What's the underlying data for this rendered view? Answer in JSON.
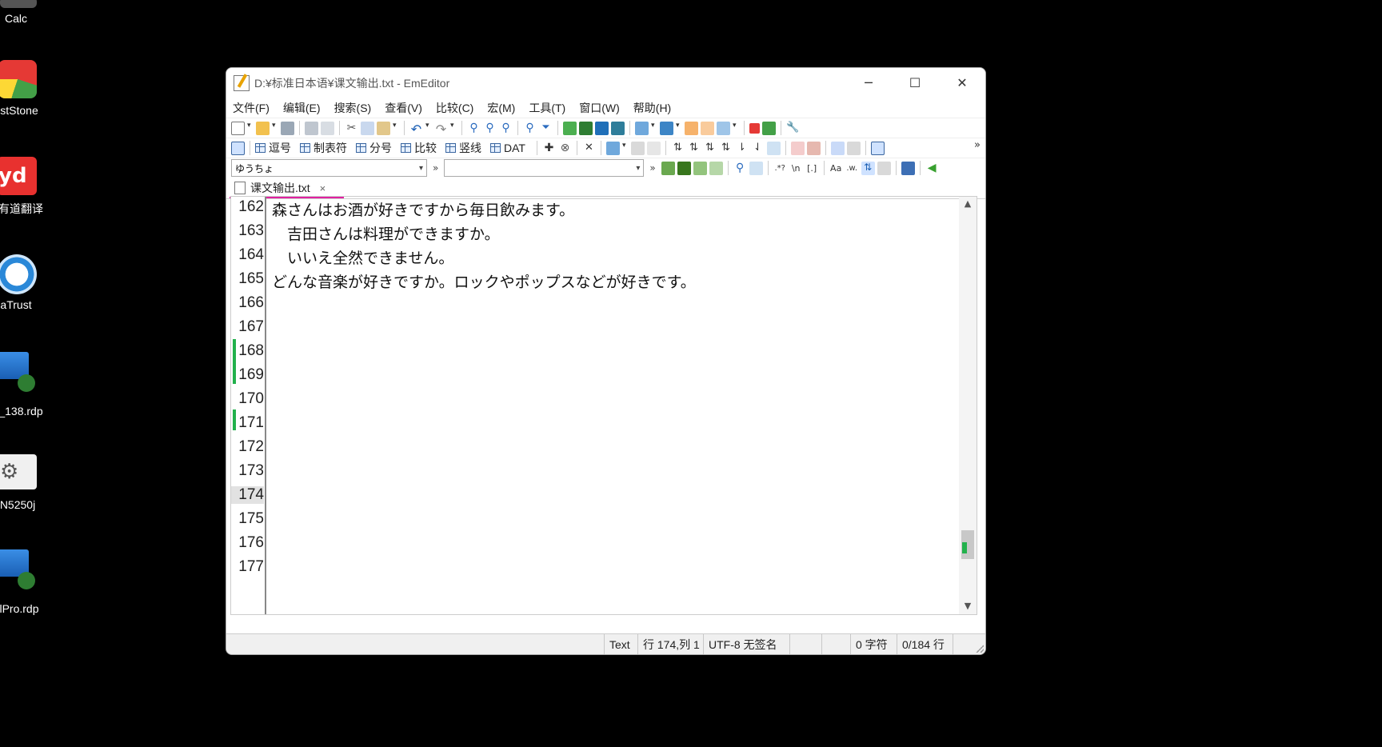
{
  "desktop": {
    "icons": [
      {
        "label": "Calc"
      },
      {
        "label": "stStone"
      },
      {
        "label": "有道翻译"
      },
      {
        "label": "aTrust"
      },
      {
        "label": "_138.rdp"
      },
      {
        "label": "N5250j"
      },
      {
        "label": "lPro.rdp"
      }
    ]
  },
  "window": {
    "title": "D:¥标准日本语¥课文输出.txt - EmEditor",
    "controls": {
      "minimize": "─",
      "maximize": "☐",
      "close": "✕"
    }
  },
  "menu": [
    "文件(F)",
    "编辑(E)",
    "搜索(S)",
    "查看(V)",
    "比较(C)",
    "宏(M)",
    "工具(T)",
    "窗口(W)",
    "帮助(H)"
  ],
  "toolbar2": {
    "captions": [
      "逗号",
      "制表符",
      "分号",
      "比较",
      "竖线",
      "DAT"
    ]
  },
  "toolbar3": {
    "font_combo": "ゆうちょ",
    "chevron": "»",
    "search_combo": ""
  },
  "tab": {
    "label": "课文输出.txt",
    "close": "×"
  },
  "editor": {
    "line_numbers": [
      "162",
      "163",
      "164",
      "165",
      "166",
      "167",
      "168",
      "169",
      "170",
      "171",
      "172",
      "173",
      "174",
      "175",
      "176",
      "177"
    ],
    "current_line": "174",
    "lines": [
      "森さんはお酒が好きですから毎日飲みます。",
      "　吉田さんは料理ができますか。",
      "　いいえ全然できません。",
      "どんな音楽が好きですか。ロックやポップスなどが好きです。"
    ]
  },
  "status": {
    "mode": "Text",
    "position": "行 174,列 1",
    "encoding": "UTF-8 无签名",
    "chars": "0 字符",
    "lines": "0/184 行"
  },
  "colors": {
    "change_marker": "#22b14c",
    "tab_underline": "#e020a0",
    "background": "#000000"
  }
}
